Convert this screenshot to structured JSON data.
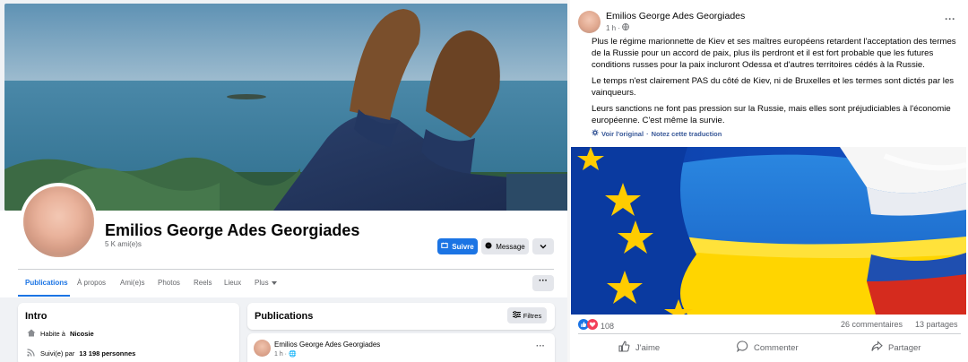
{
  "profile": {
    "name": "Emilios George Ades Georgiades",
    "friends": "5 K ami(e)s",
    "follow_label": "Suivre",
    "message_label": "Message"
  },
  "tabs": [
    "Publications",
    "À propos",
    "Ami(e)s",
    "Photos",
    "Reels",
    "Lieux",
    "Plus"
  ],
  "intro": {
    "title": "Intro",
    "lives_prefix": "Habite à",
    "lives_city": "Nicosie",
    "followed_prefix": "Suivi(e) par",
    "followed_count": "13 198 personnes"
  },
  "publications": {
    "title": "Publications",
    "filters_label": "Filtres",
    "post_author": "Emilios George Ades Georgiades",
    "post_time": "1 h ·"
  },
  "post": {
    "author": "Emilios George Ades Georgiades",
    "time": "1 h ·",
    "paragraphs": [
      "Plus le régime marionnette de Kiev et ses maîtres européens retardent l'acceptation des termes de la Russie pour un accord de paix, plus ils perdront et il est fort probable que les futures conditions russes pour la paix incluront Odessa et d'autres territoires cédés à la Russie.",
      "Le temps n'est clairement PAS du côté de Kiev, ni de Bruxelles et les termes sont dictés par les vainqueurs.",
      "Leurs sanctions ne font pas pression sur la Russie, mais elles sont préjudiciables à l'économie européenne. C'est même la survie."
    ],
    "see_original": "Voir l'original",
    "rate_translation": "Notez cette traduction",
    "reactions_count": "108",
    "comments": "26 commentaires",
    "shares": "13 partages",
    "like_label": "J'aime",
    "comment_label": "Commenter",
    "share_label": "Partager"
  },
  "colors": {
    "facebook_blue": "#1b74e4",
    "eu_blue": "#003399",
    "eu_star": "#ffcc00",
    "ukraine_blue": "#0057b7",
    "ukraine_yellow": "#ffd700",
    "russia_red": "#d52b1e"
  }
}
